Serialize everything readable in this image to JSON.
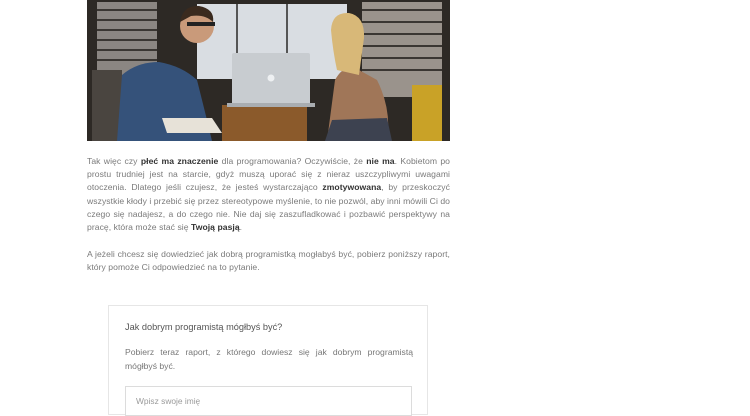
{
  "article": {
    "p1": {
      "t1": "Tak więc czy ",
      "b1": "płeć ma znaczenie",
      "t2": " dla programowania? Oczywiście, że ",
      "b2": "nie ma",
      "t3": ". Kobietom po prostu trudniej jest na starcie, gdyż muszą uporać się z nieraz uszczypliwymi uwagami otoczenia. Dlatego jeśli czujesz, że jesteś wystarczająco ",
      "b3": "zmotywowana",
      "t4": ", by przeskoczyć wszystkie kłody i przebić się przez stereotypowe myślenie, to nie pozwól, aby inni mówili Ci do czego się nadajesz, a do czego nie. Nie daj się zaszufladkować i pozbawić perspektywy na pracę, która może stać się ",
      "b4": "Twoją pasją",
      "t5": "."
    },
    "p2": "A jeżeli chcesz się dowiedzieć jak dobrą programistką mogłabyś być, pobierz poniższy raport, który pomoże Ci odpowiedzieć na to pytanie."
  },
  "form": {
    "title": "Jak dobrym programistą mógłbyś być?",
    "description": "Pobierz teraz raport, z którego dowiesz się jak dobrym programistą mógłbyś być.",
    "name_placeholder": "Wpisz swoje imię"
  }
}
